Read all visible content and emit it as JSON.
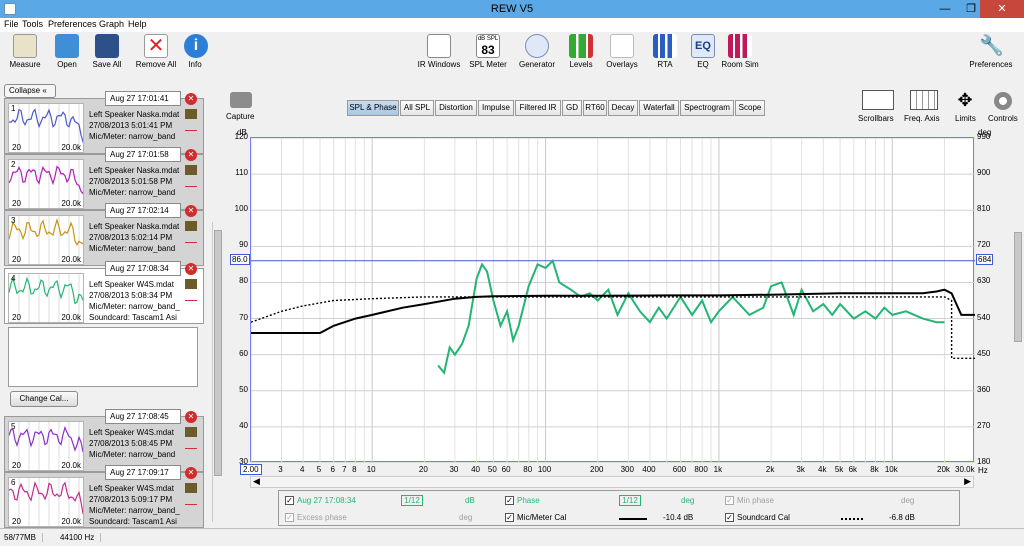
{
  "window": {
    "title": "REW V5"
  },
  "menu": [
    "File",
    "Tools",
    "Preferences",
    "Graph",
    "Help"
  ],
  "toolbar": {
    "left": [
      {
        "label": "Measure",
        "icon": "measure-icon"
      },
      {
        "label": "Open",
        "icon": "folder-icon"
      },
      {
        "label": "Save All",
        "icon": "save-icon"
      },
      {
        "label": "Remove All",
        "icon": "remove-icon"
      },
      {
        "label": "Info",
        "icon": "info-icon"
      }
    ],
    "center": [
      {
        "label": "IR Windows",
        "icon": "ir-windows-icon"
      },
      {
        "label": "SPL Meter",
        "icon": "spl-meter-icon",
        "badge_top": "dB SPL",
        "badge_value": "83"
      },
      {
        "label": "Generator",
        "icon": "generator-icon"
      },
      {
        "label": "Levels",
        "icon": "levels-icon"
      },
      {
        "label": "Overlays",
        "icon": "overlays-icon"
      },
      {
        "label": "RTA",
        "icon": "rta-icon"
      },
      {
        "label": "EQ",
        "icon": "eq-icon"
      },
      {
        "label": "Room Sim",
        "icon": "room-sim-icon"
      }
    ],
    "right": {
      "label": "Preferences",
      "icon": "wrench-icon"
    }
  },
  "panel": {
    "collapse_label": "Collapse",
    "change_cal_label": "Change Cal...",
    "measurements": [
      {
        "num": "1",
        "stamp": "Aug 27 17:01:41",
        "line1": "Left Speaker Naska.mdat",
        "line2": "27/08/2013 5:01:41 PM",
        "line3": "Mic/Meter: narrow_band",
        "lo": "20",
        "hi": "20.0k",
        "color": "#4b58c8"
      },
      {
        "num": "2",
        "stamp": "Aug 27 17:01:58",
        "line1": "Left Speaker Naska.mdat",
        "line2": "27/08/2013 5:01:58 PM",
        "line3": "Mic/Meter: narrow_band",
        "lo": "20",
        "hi": "20.0k",
        "color": "#b21cb4"
      },
      {
        "num": "3",
        "stamp": "Aug 27 17:02:14",
        "line1": "Left Speaker Naska.mdat",
        "line2": "27/08/2013 5:02:14 PM",
        "line3": "Mic/Meter: narrow_band",
        "lo": "20",
        "hi": "20.0k",
        "color": "#c6960e"
      },
      {
        "num": "4",
        "stamp": "Aug 27 17:08:34",
        "line1": "Left Speaker W4S.mdat",
        "line2": "27/08/2013 5:08:34 PM",
        "line3": "Mic/Meter: narrow_band_",
        "line4": "Soundcard: Tascam1 Asi",
        "lo": "20",
        "hi": "20.0k",
        "color": "#22b573"
      },
      {
        "num": "5",
        "stamp": "Aug 27 17:08:45",
        "line1": "Left Speaker W4S.mdat",
        "line2": "27/08/2013 5:08:45 PM",
        "line3": "Mic/Meter: narrow_band",
        "lo": "20",
        "hi": "20.0k",
        "color": "#8b2fc9"
      },
      {
        "num": "6",
        "stamp": "Aug 27 17:09:17",
        "line1": "Left Speaker W4S.mdat",
        "line2": "27/08/2013 5:09:17 PM",
        "line3": "Mic/Meter: narrow_band_",
        "line4": "Soundcard: Tascam1 Asi",
        "lo": "20",
        "hi": "20.0k",
        "color": "#c42a8c"
      }
    ]
  },
  "graph_tools": {
    "capture_label": "Capture",
    "right": [
      {
        "label": "Scrollbars",
        "icon": "scrollbars-icon"
      },
      {
        "label": "Freq. Axis",
        "icon": "freq-axis-icon"
      },
      {
        "label": "Limits",
        "icon": "limits-icon"
      },
      {
        "label": "Controls",
        "icon": "gear-icon"
      }
    ]
  },
  "tabs": [
    "SPL & Phase",
    "All SPL",
    "Distortion",
    "Impulse",
    "Filtered IR",
    "GD",
    "RT60",
    "Decay",
    "Waterfall",
    "Spectrogram",
    "Scope"
  ],
  "active_tab": "SPL & Phase",
  "chart_data": {
    "type": "line",
    "y_unit_left": "dB",
    "y_unit_right": "deg",
    "x_unit": "Hz",
    "xlim": [
      2.0,
      30000
    ],
    "ylim": [
      30,
      120
    ],
    "ylim_right": [
      180,
      990
    ],
    "x_scale": "log",
    "grid": true,
    "y_ticks": [
      30,
      40,
      50,
      60,
      70,
      80,
      90,
      100,
      110,
      120
    ],
    "y_ticks_right": [
      180,
      270,
      360,
      450,
      540,
      630,
      720,
      810,
      900,
      990
    ],
    "x_ticks": [
      {
        "v": 2,
        "l": "2.00"
      },
      {
        "v": 3,
        "l": "3"
      },
      {
        "v": 4,
        "l": "4"
      },
      {
        "v": 5,
        "l": "5"
      },
      {
        "v": 6,
        "l": "6"
      },
      {
        "v": 7,
        "l": "7"
      },
      {
        "v": 8,
        "l": "8"
      },
      {
        "v": 10,
        "l": "10"
      },
      {
        "v": 20,
        "l": "20"
      },
      {
        "v": 30,
        "l": "30"
      },
      {
        "v": 40,
        "l": "40"
      },
      {
        "v": 50,
        "l": "50"
      },
      {
        "v": 60,
        "l": "60"
      },
      {
        "v": 80,
        "l": "80"
      },
      {
        "v": 100,
        "l": "100"
      },
      {
        "v": 200,
        "l": "200"
      },
      {
        "v": 300,
        "l": "300"
      },
      {
        "v": 400,
        "l": "400"
      },
      {
        "v": 600,
        "l": "600"
      },
      {
        "v": 800,
        "l": "800"
      },
      {
        "v": 1000,
        "l": "1k"
      },
      {
        "v": 2000,
        "l": "2k"
      },
      {
        "v": 3000,
        "l": "3k"
      },
      {
        "v": 4000,
        "l": "4k"
      },
      {
        "v": 5000,
        "l": "5k"
      },
      {
        "v": 6000,
        "l": "6k"
      },
      {
        "v": 8000,
        "l": "8k"
      },
      {
        "v": 10000,
        "l": "10k"
      },
      {
        "v": 20000,
        "l": "20k"
      },
      {
        "v": 30000,
        "l": "30.0k"
      }
    ],
    "cursor_left": "86.0",
    "cursor_right": "684",
    "cursor_level": 86,
    "series": [
      {
        "name": "Aug 27 17:08:34",
        "color": "#22b573",
        "x": [
          24,
          26,
          28,
          30,
          33,
          36,
          40,
          43,
          46,
          50,
          55,
          60,
          65,
          70,
          80,
          90,
          100,
          110,
          120,
          140,
          160,
          180,
          200,
          230,
          260,
          300,
          350,
          400,
          450,
          500,
          600,
          700,
          800,
          900,
          1000,
          1200,
          1500,
          1800,
          2000,
          2300,
          2700,
          3000,
          3500,
          4000,
          4500,
          5000,
          6000,
          7000,
          8000,
          9000,
          10000,
          12000,
          15000,
          18000,
          20000
        ],
        "y": [
          57,
          55,
          62,
          60,
          63,
          68,
          81,
          85,
          83,
          75,
          68,
          72,
          64,
          68,
          79,
          85,
          84,
          86,
          80,
          78,
          76,
          77,
          75,
          78,
          71,
          77,
          72,
          69,
          73,
          70,
          76,
          71,
          75,
          69,
          72,
          76,
          71,
          73,
          79,
          80,
          71,
          78,
          72,
          74,
          71,
          74,
          70,
          72,
          70,
          73,
          71,
          72,
          70,
          69,
          69
        ]
      },
      {
        "name": "Mic/Meter Cal",
        "color": "#000000",
        "x": [
          2,
          4,
          5,
          6,
          8,
          10,
          15,
          20,
          30,
          40,
          50,
          100,
          200,
          500,
          1000,
          2000,
          5000,
          10000,
          15000,
          18000,
          20000,
          22000,
          25000,
          30000
        ],
        "y": [
          66,
          66,
          66,
          68,
          70,
          71,
          73,
          74,
          75.5,
          76,
          76.2,
          76.3,
          76.3,
          76.4,
          76.4,
          76.6,
          77,
          77,
          77,
          77.5,
          78,
          77,
          71,
          71
        ]
      },
      {
        "name": "Soundcard Cal",
        "color": "#000000",
        "dash": true,
        "x": [
          2,
          3,
          4,
          6,
          10,
          20,
          50,
          100,
          1000,
          10000,
          20000,
          22000,
          22000,
          30000
        ],
        "y": [
          69,
          72,
          73.5,
          75,
          75.5,
          76,
          76,
          76,
          76,
          76,
          76,
          75,
          59,
          59
        ]
      }
    ]
  },
  "legend": [
    {
      "label": "Aug 27 17:08:34",
      "color": "#22b573",
      "checked": true,
      "smoothing": "1/12",
      "unit": "dB"
    },
    {
      "label": "Phase",
      "color": "#22b573",
      "checked": true,
      "smoothing": "1/12",
      "unit": "deg"
    },
    {
      "label": "Min phase",
      "color": "#a0a0a0",
      "checked": true,
      "unit": "deg"
    },
    {
      "label": "Excess phase",
      "color": "#a0a0a0",
      "checked": true,
      "unit": "deg"
    },
    {
      "label": "Mic/Meter Cal",
      "color": "#000000",
      "checked": true,
      "value": "-10.4 dB"
    },
    {
      "label": "Soundcard Cal",
      "color": "#000000",
      "checked": true,
      "value": "-6.8 dB"
    }
  ],
  "status": {
    "memory": "58/77MB",
    "rate": "44100 Hz"
  }
}
